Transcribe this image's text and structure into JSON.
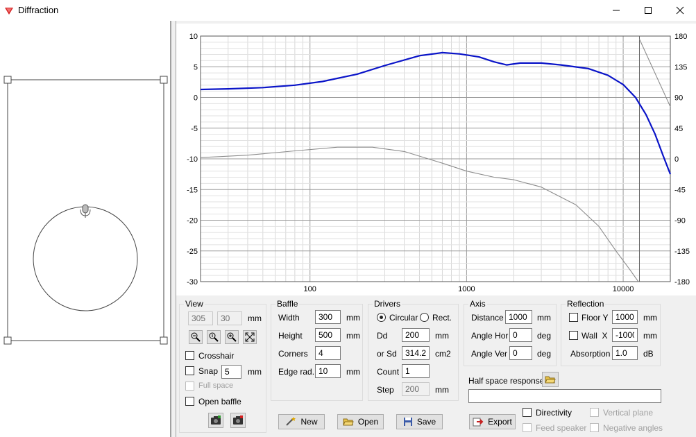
{
  "window": {
    "title": "Diffraction"
  },
  "chart_data": {
    "type": "line",
    "x_scale": "log",
    "xlim": [
      20,
      20000
    ],
    "ylim": [
      -30,
      10
    ],
    "y2lim": [
      -180,
      180
    ],
    "x_ticks": [
      "100",
      "1000",
      "10000"
    ],
    "y_ticks": [
      "10",
      "5",
      "0",
      "-5",
      "-10",
      "-15",
      "-20",
      "-25",
      "-30"
    ],
    "y2_ticks": [
      "180",
      "135",
      "90",
      "45",
      "0",
      "-45",
      "-90",
      "-135",
      "-180"
    ],
    "grid": true,
    "series": [
      {
        "color": "#0a14c8",
        "x": [
          20,
          30,
          50,
          80,
          120,
          200,
          300,
          500,
          700,
          900,
          1200,
          1500,
          1800,
          2200,
          3000,
          4000,
          6000,
          8000,
          10000,
          12000,
          14000,
          16000,
          18000,
          20000
        ],
        "y": [
          1.3,
          1.4,
          1.6,
          2.0,
          2.6,
          3.8,
          5.2,
          6.8,
          7.3,
          7.1,
          6.6,
          5.8,
          5.3,
          5.6,
          5.6,
          5.3,
          4.7,
          3.6,
          2.1,
          0.0,
          -2.8,
          -6.0,
          -9.5,
          -12.5
        ]
      },
      {
        "color": "#8c8c8c",
        "x": [
          20,
          40,
          80,
          150,
          250,
          400,
          700,
          1000,
          1500,
          2000,
          3000,
          5000,
          7000,
          9000,
          11000,
          12500
        ],
        "y": [
          -9.8,
          -9.4,
          -8.7,
          -8.1,
          -8.1,
          -8.8,
          -10.7,
          -12.0,
          -13.0,
          -13.4,
          -14.6,
          -17.5,
          -21.0,
          -25.0,
          -28.0,
          -30.0
        ]
      },
      {
        "color": "#8c8c8c",
        "x": [
          12700,
          20000
        ],
        "y": [
          9.5,
          -1.5
        ]
      }
    ],
    "vline_x": 12700
  },
  "view": {
    "title": "View",
    "x_value": "305",
    "y_value": "30",
    "unit": "mm",
    "crosshair_label": "Crosshair",
    "snap_label": "Snap",
    "snap_value": "5",
    "snap_unit": "mm",
    "full_space_label": "Full space",
    "open_baffle_label": "Open baffle"
  },
  "baffle": {
    "title": "Baffle",
    "width_label": "Width",
    "width_value": "300",
    "width_unit": "mm",
    "height_label": "Height",
    "height_value": "500",
    "height_unit": "mm",
    "corners_label": "Corners",
    "corners_value": "4",
    "edge_label": "Edge rad.",
    "edge_value": "10",
    "edge_unit": "mm"
  },
  "drivers": {
    "title": "Drivers",
    "circular_label": "Circular",
    "rect_label": "Rect.",
    "dd_label": "Dd",
    "dd_value": "200",
    "dd_unit": "mm",
    "sd_label": "or Sd",
    "sd_value": "314.2",
    "sd_unit": "cm2",
    "count_label": "Count",
    "count_value": "1",
    "step_label": "Step",
    "step_value": "200",
    "step_unit": "mm"
  },
  "axis": {
    "title": "Axis",
    "distance_label": "Distance",
    "distance_value": "1000",
    "distance_unit": "mm",
    "angle_hor_label": "Angle Hor",
    "angle_hor_value": "0",
    "angle_hor_unit": "deg",
    "angle_ver_label": "Angle Ver",
    "angle_ver_value": "0",
    "angle_ver_unit": "deg"
  },
  "reflection": {
    "title": "Reflection",
    "floor_label": "Floor Y",
    "floor_value": "1000",
    "floor_unit": "mm",
    "wall_label": "Wall  X",
    "wall_value": "-1000",
    "wall_unit": "mm",
    "absorption_label": "Absorption",
    "absorption_value": "1.0",
    "absorption_unit": "dB"
  },
  "half_space": {
    "label": "Half space response",
    "value": ""
  },
  "buttons": {
    "new": "New",
    "open": "Open",
    "save": "Save",
    "export": "Export"
  },
  "options": {
    "directivity": "Directivity",
    "feed_speaker": "Feed speaker",
    "vertical_plane": "Vertical plane",
    "negative_angles": "Negative angles"
  }
}
